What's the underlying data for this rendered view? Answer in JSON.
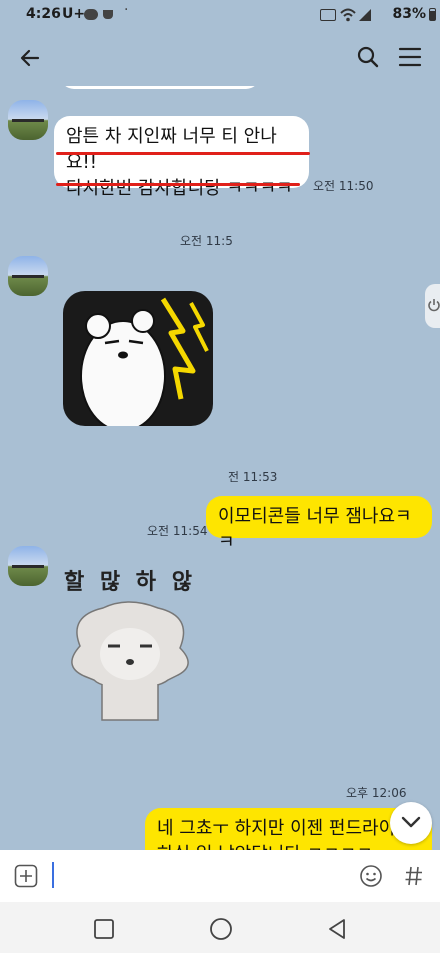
{
  "status": {
    "time": "4:26",
    "carrier": "U+",
    "battery": "83%"
  },
  "chat": {
    "msg1_line1": "암튼 차 지인짜 너무 티 안나요!!",
    "msg1_line2": "다시한번 감사합니당 ㅋㅋㅋㅋ",
    "time1": "오전 11:50",
    "time2": "오전 11:5",
    "time3": "전 11:53",
    "msg_mine": "이모티콘들 너무 잼나요ㅋㅋ",
    "time4": "오전 11:54",
    "sticker2_text": "할 많 하 않",
    "time5": "오후 12:06",
    "msg_last": "네 그쵸ㅜ 하지만 이젠 펀드라이빙",
    "msg_last_line2": "하실 일 남았답니다 ㅋㅋㅋㅋ"
  },
  "colors": {
    "background": "#a9bfd3",
    "my_bubble": "#fee500",
    "their_bubble": "#ffffff",
    "underline": "#e0201a"
  },
  "icons": [
    "back-arrow-icon",
    "search-icon",
    "menu-icon",
    "plus-icon",
    "emoji-icon",
    "hashtag-icon",
    "chevron-down-icon",
    "power-icon",
    "recent-apps-icon",
    "home-icon",
    "back-nav-icon"
  ]
}
